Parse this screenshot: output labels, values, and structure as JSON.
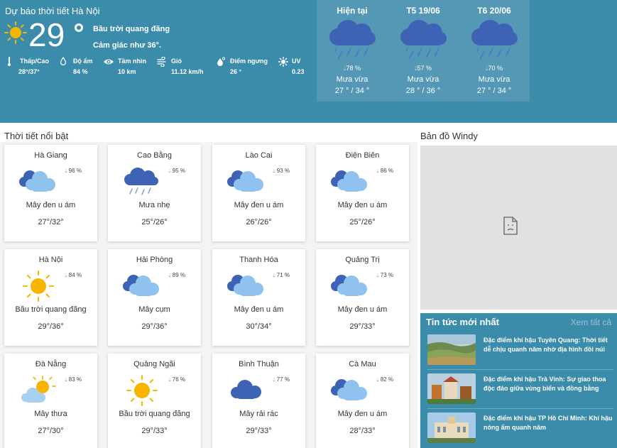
{
  "header": {
    "title": "Dự báo thời tiết Hà Nội",
    "temp": "29",
    "condition": "Bầu trời quang đãng",
    "feels_like": "Cảm giác như 36°.",
    "stats": [
      {
        "icon": "thermometer-icon",
        "label": "Thấp/Cao",
        "value": "28°/37°"
      },
      {
        "icon": "humidity-icon",
        "label": "Độ ẩm",
        "value": "84 %"
      },
      {
        "icon": "eye-icon",
        "label": "Tầm nhìn",
        "value": "10 km"
      },
      {
        "icon": "wind-icon",
        "label": "Gió",
        "value": "11.12 km/h"
      },
      {
        "icon": "dewpoint-icon",
        "label": "Điểm ngưng",
        "value": "26 °"
      },
      {
        "icon": "uv-icon",
        "label": "UV",
        "value": "0.23"
      }
    ]
  },
  "forecast": [
    {
      "day": "Hiện tại",
      "humidity": "78 %",
      "desc": "Mưa vừa",
      "range": "27 ° / 34 °",
      "icon": "rain-cloud-icon"
    },
    {
      "day": "T5 19/06",
      "humidity": "57 %",
      "desc": "Mưa vừa",
      "range": "28 ° / 36 °",
      "icon": "rain-cloud-icon"
    },
    {
      "day": "T6 20/06",
      "humidity": "70 %",
      "desc": "Mưa vừa",
      "range": "27 ° / 34 °",
      "icon": "rain-cloud-icon"
    }
  ],
  "highlights": {
    "title": "Thời tiết nổi bật",
    "cities": [
      {
        "name": "Hà Giang",
        "humidity": "96 %",
        "desc": "Mây đen u ám",
        "range": "27°/32°",
        "icon": "overcast"
      },
      {
        "name": "Cao Bằng",
        "humidity": "95 %",
        "desc": "Mưa nhẹ",
        "range": "25°/26°",
        "icon": "rain"
      },
      {
        "name": "Lào Cai",
        "humidity": "93 %",
        "desc": "Mây đen u ám",
        "range": "26°/26°",
        "icon": "overcast"
      },
      {
        "name": "Điện Biên",
        "humidity": "86 %",
        "desc": "Mây đen u ám",
        "range": "25°/26°",
        "icon": "overcast"
      },
      {
        "name": "Hà Nội",
        "humidity": "84 %",
        "desc": "Bầu trời quang đãng",
        "range": "29°/36°",
        "icon": "sun"
      },
      {
        "name": "Hải Phòng",
        "humidity": "89 %",
        "desc": "Mây cụm",
        "range": "29°/36°",
        "icon": "overcast"
      },
      {
        "name": "Thanh Hóa",
        "humidity": "71 %",
        "desc": "Mây đen u ám",
        "range": "30°/34°",
        "icon": "overcast"
      },
      {
        "name": "Quảng Trị",
        "humidity": "73 %",
        "desc": "Mây đen u ám",
        "range": "29°/33°",
        "icon": "overcast"
      },
      {
        "name": "Đà Nẵng",
        "humidity": "83 %",
        "desc": "Mây thưa",
        "range": "27°/30°",
        "icon": "partly"
      },
      {
        "name": "Quảng Ngãi",
        "humidity": "76 %",
        "desc": "Bầu trời quang đãng",
        "range": "29°/33°",
        "icon": "sun"
      },
      {
        "name": "Bình Thuận",
        "humidity": "77 %",
        "desc": "Mây rải rác",
        "range": "29°/33°",
        "icon": "scattered"
      },
      {
        "name": "Cà Mau",
        "humidity": "82 %",
        "desc": "Mây đen u ám",
        "range": "28°/33°",
        "icon": "overcast"
      }
    ]
  },
  "map": {
    "title": "Bản đồ Windy",
    "icon": "broken-document-icon"
  },
  "news": {
    "title": "Tin tức mới nhất",
    "view_all": "Xem tất cả",
    "items": [
      {
        "text": "Đặc điểm khí hậu Tuyên Quang: Thời tiết dễ chịu quanh năm nhờ địa hình đồi núi"
      },
      {
        "text": "Đặc điểm khí hậu Trà Vinh: Sự giao thoa độc đáo giữa vùng biển và đồng bằng"
      },
      {
        "text": "Đặc điểm khí hậu TP Hồ Chí Minh: Khí hậu nóng ẩm quanh năm"
      }
    ]
  },
  "colors": {
    "header_bg": "#3b8bab",
    "forecast_card": "#5598b5",
    "cloud_dark": "#3f63b4",
    "cloud_light": "#8fc2ef",
    "sun": "#f7b500"
  }
}
